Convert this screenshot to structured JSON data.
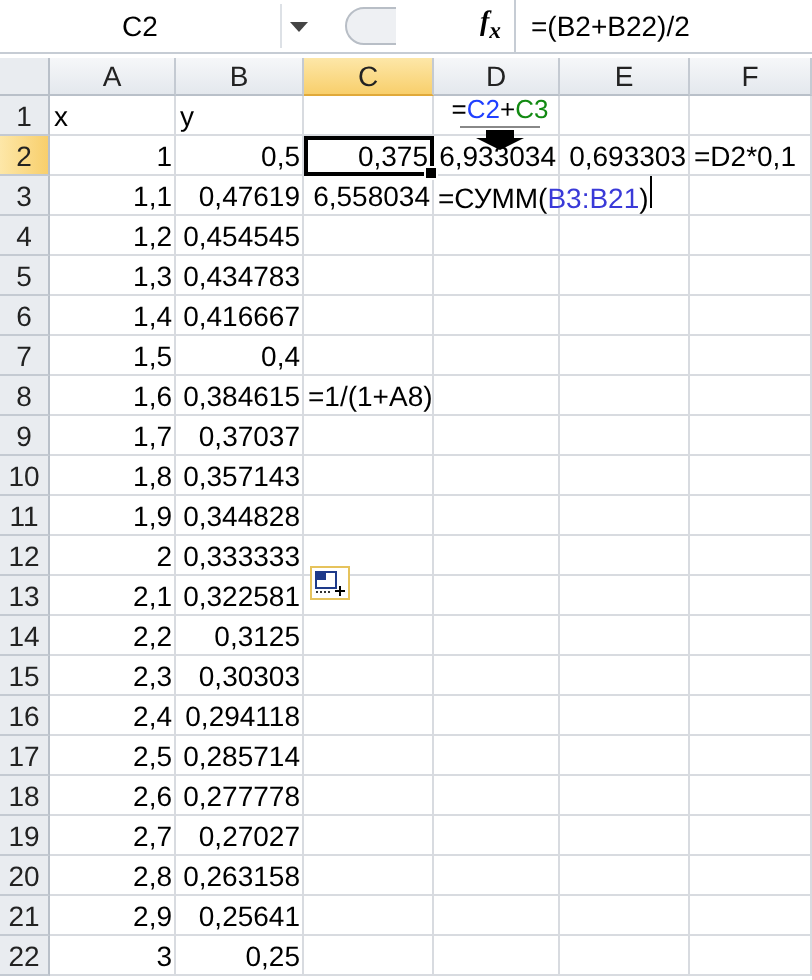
{
  "name_box": "C2",
  "formula_bar": {
    "function_label": "f$_{x}$",
    "formula": "=(B2+B22)/2"
  },
  "columns": [
    {
      "label": "A",
      "selected": false
    },
    {
      "label": "B",
      "selected": false
    },
    {
      "label": "C",
      "selected": true
    },
    {
      "label": "D",
      "selected": false
    },
    {
      "label": "E",
      "selected": false
    },
    {
      "label": "F",
      "selected": false
    }
  ],
  "formula_hint": {
    "parts": [
      {
        "text": "=",
        "color": "#000000"
      },
      {
        "text": "C2",
        "color": "#1f3fff"
      },
      {
        "text": "+",
        "color": "#000000"
      },
      {
        "text": "C3",
        "color": "#128a12"
      }
    ]
  },
  "rows": [
    {
      "label": "1",
      "selected": false,
      "cells": [
        {
          "kind": "text",
          "text": "x"
        },
        {
          "kind": "text",
          "text": "y"
        },
        {
          "kind": "empty"
        },
        {
          "kind": "empty"
        },
        {
          "kind": "empty"
        },
        {
          "kind": "empty"
        }
      ]
    },
    {
      "label": "2",
      "selected": true,
      "cells": [
        {
          "kind": "number",
          "text": "1"
        },
        {
          "kind": "number",
          "text": "0,5"
        },
        {
          "kind": "number",
          "text": "0,375",
          "selected": true
        },
        {
          "kind": "number",
          "text": "6,933034"
        },
        {
          "kind": "number",
          "text": "0,693303"
        },
        {
          "kind": "text",
          "text": "=D2*0,1"
        }
      ]
    },
    {
      "label": "3",
      "selected": false,
      "cells": [
        {
          "kind": "number",
          "text": "1,1"
        },
        {
          "kind": "number",
          "text": "0,47619"
        },
        {
          "kind": "number",
          "text": "6,558034"
        },
        {
          "kind": "editing",
          "parts": [
            {
              "text": "=СУММ(",
              "color": "#000000"
            },
            {
              "text": "B3:B21",
              "color": "#3a3ad8"
            },
            {
              "text": ")",
              "color": "#000000"
            }
          ]
        },
        {
          "kind": "empty"
        },
        {
          "kind": "empty"
        }
      ]
    },
    {
      "label": "4",
      "selected": false,
      "cells": [
        {
          "kind": "number",
          "text": "1,2"
        },
        {
          "kind": "number",
          "text": "0,454545"
        },
        {
          "kind": "empty"
        },
        {
          "kind": "empty"
        },
        {
          "kind": "empty"
        },
        {
          "kind": "empty"
        }
      ]
    },
    {
      "label": "5",
      "selected": false,
      "cells": [
        {
          "kind": "number",
          "text": "1,3"
        },
        {
          "kind": "number",
          "text": "0,434783"
        },
        {
          "kind": "empty"
        },
        {
          "kind": "empty"
        },
        {
          "kind": "empty"
        },
        {
          "kind": "empty"
        }
      ]
    },
    {
      "label": "6",
      "selected": false,
      "cells": [
        {
          "kind": "number",
          "text": "1,4"
        },
        {
          "kind": "number",
          "text": "0,416667"
        },
        {
          "kind": "empty"
        },
        {
          "kind": "empty"
        },
        {
          "kind": "empty"
        },
        {
          "kind": "empty"
        }
      ]
    },
    {
      "label": "7",
      "selected": false,
      "cells": [
        {
          "kind": "number",
          "text": "1,5"
        },
        {
          "kind": "number",
          "text": "0,4"
        },
        {
          "kind": "empty"
        },
        {
          "kind": "empty"
        },
        {
          "kind": "empty"
        },
        {
          "kind": "empty"
        }
      ]
    },
    {
      "label": "8",
      "selected": false,
      "cells": [
        {
          "kind": "number",
          "text": "1,6"
        },
        {
          "kind": "number",
          "text": "0,384615"
        },
        {
          "kind": "text",
          "text": "=1/(1+A8)"
        },
        {
          "kind": "empty"
        },
        {
          "kind": "empty"
        },
        {
          "kind": "empty"
        }
      ]
    },
    {
      "label": "9",
      "selected": false,
      "cells": [
        {
          "kind": "number",
          "text": "1,7"
        },
        {
          "kind": "number",
          "text": "0,37037"
        },
        {
          "kind": "empty"
        },
        {
          "kind": "empty"
        },
        {
          "kind": "empty"
        },
        {
          "kind": "empty"
        }
      ]
    },
    {
      "label": "10",
      "selected": false,
      "cells": [
        {
          "kind": "number",
          "text": "1,8"
        },
        {
          "kind": "number",
          "text": "0,357143"
        },
        {
          "kind": "empty"
        },
        {
          "kind": "empty"
        },
        {
          "kind": "empty"
        },
        {
          "kind": "empty"
        }
      ]
    },
    {
      "label": "11",
      "selected": false,
      "cells": [
        {
          "kind": "number",
          "text": "1,9"
        },
        {
          "kind": "number",
          "text": "0,344828"
        },
        {
          "kind": "empty"
        },
        {
          "kind": "empty"
        },
        {
          "kind": "empty"
        },
        {
          "kind": "empty"
        }
      ]
    },
    {
      "label": "12",
      "selected": false,
      "cells": [
        {
          "kind": "number",
          "text": "2"
        },
        {
          "kind": "number",
          "text": "0,333333"
        },
        {
          "kind": "empty"
        },
        {
          "kind": "empty"
        },
        {
          "kind": "empty"
        },
        {
          "kind": "empty"
        }
      ]
    },
    {
      "label": "13",
      "selected": false,
      "cells": [
        {
          "kind": "number",
          "text": "2,1"
        },
        {
          "kind": "number",
          "text": "0,322581"
        },
        {
          "kind": "empty"
        },
        {
          "kind": "empty"
        },
        {
          "kind": "empty"
        },
        {
          "kind": "empty"
        }
      ]
    },
    {
      "label": "14",
      "selected": false,
      "cells": [
        {
          "kind": "number",
          "text": "2,2"
        },
        {
          "kind": "number",
          "text": "0,3125"
        },
        {
          "kind": "empty"
        },
        {
          "kind": "empty"
        },
        {
          "kind": "empty"
        },
        {
          "kind": "empty"
        }
      ]
    },
    {
      "label": "15",
      "selected": false,
      "cells": [
        {
          "kind": "number",
          "text": "2,3"
        },
        {
          "kind": "number",
          "text": "0,30303"
        },
        {
          "kind": "empty"
        },
        {
          "kind": "empty"
        },
        {
          "kind": "empty"
        },
        {
          "kind": "empty"
        }
      ]
    },
    {
      "label": "16",
      "selected": false,
      "cells": [
        {
          "kind": "number",
          "text": "2,4"
        },
        {
          "kind": "number",
          "text": "0,294118"
        },
        {
          "kind": "empty"
        },
        {
          "kind": "empty"
        },
        {
          "kind": "empty"
        },
        {
          "kind": "empty"
        }
      ]
    },
    {
      "label": "17",
      "selected": false,
      "cells": [
        {
          "kind": "number",
          "text": "2,5"
        },
        {
          "kind": "number",
          "text": "0,285714"
        },
        {
          "kind": "empty"
        },
        {
          "kind": "empty"
        },
        {
          "kind": "empty"
        },
        {
          "kind": "empty"
        }
      ]
    },
    {
      "label": "18",
      "selected": false,
      "cells": [
        {
          "kind": "number",
          "text": "2,6"
        },
        {
          "kind": "number",
          "text": "0,277778"
        },
        {
          "kind": "empty"
        },
        {
          "kind": "empty"
        },
        {
          "kind": "empty"
        },
        {
          "kind": "empty"
        }
      ]
    },
    {
      "label": "19",
      "selected": false,
      "cells": [
        {
          "kind": "number",
          "text": "2,7"
        },
        {
          "kind": "number",
          "text": "0,27027"
        },
        {
          "kind": "empty"
        },
        {
          "kind": "empty"
        },
        {
          "kind": "empty"
        },
        {
          "kind": "empty"
        }
      ]
    },
    {
      "label": "20",
      "selected": false,
      "cells": [
        {
          "kind": "number",
          "text": "2,8"
        },
        {
          "kind": "number",
          "text": "0,263158"
        },
        {
          "kind": "empty"
        },
        {
          "kind": "empty"
        },
        {
          "kind": "empty"
        },
        {
          "kind": "empty"
        }
      ]
    },
    {
      "label": "21",
      "selected": false,
      "cells": [
        {
          "kind": "number",
          "text": "2,9"
        },
        {
          "kind": "number",
          "text": "0,25641"
        },
        {
          "kind": "empty"
        },
        {
          "kind": "empty"
        },
        {
          "kind": "empty"
        },
        {
          "kind": "empty"
        }
      ]
    },
    {
      "label": "22",
      "selected": false,
      "cells": [
        {
          "kind": "number",
          "text": "3"
        },
        {
          "kind": "number",
          "text": "0,25"
        },
        {
          "kind": "empty"
        },
        {
          "kind": "empty"
        },
        {
          "kind": "empty"
        },
        {
          "kind": "empty"
        }
      ]
    }
  ]
}
